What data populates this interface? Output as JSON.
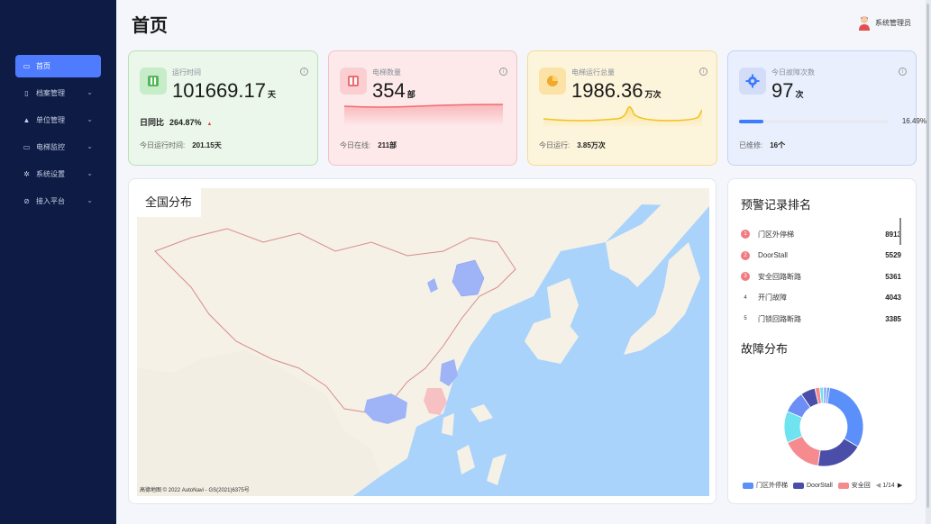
{
  "sidebar": {
    "items": [
      {
        "label": "首页",
        "icon": "monitor-icon",
        "active": true
      },
      {
        "label": "档案管理",
        "icon": "file-icon",
        "active": false
      },
      {
        "label": "单位管理",
        "icon": "building-icon",
        "active": false
      },
      {
        "label": "电梯监控",
        "icon": "screen-icon",
        "active": false
      },
      {
        "label": "系统设置",
        "icon": "gear-icon",
        "active": false
      },
      {
        "label": "接入平台",
        "icon": "link-icon",
        "active": false
      }
    ]
  },
  "header": {
    "title": "首页",
    "user": "系统管理员"
  },
  "cards": [
    {
      "label": "运行时间",
      "value": "101669.17",
      "unit": "天",
      "yoy_label": "日同比",
      "yoy_value": "264.87%",
      "foot_label": "今日运行时间:",
      "foot_value": "201.15天"
    },
    {
      "label": "电梯数量",
      "value": "354",
      "unit": "部",
      "foot_label": "今日在线:",
      "foot_value": "211部"
    },
    {
      "label": "电梯运行总量",
      "value": "1986.36",
      "unit": "万次",
      "foot_label": "今日运行:",
      "foot_value": "3.85万次"
    },
    {
      "label": "今日故障次数",
      "value": "97",
      "unit": "次",
      "progress_pct": "16.49%",
      "progress": 0.1649,
      "foot_label": "已维修:",
      "foot_value": "16个"
    }
  ],
  "map": {
    "title": "全国分布",
    "credit": "高德地图 © 2022 AutoNavi - GS(2021)6375号"
  },
  "ranking": {
    "title": "预警记录排名",
    "rows": [
      {
        "rank": "1",
        "name": "门区外停梯",
        "value": "8913"
      },
      {
        "rank": "2",
        "name": "DoorStall",
        "value": "5529"
      },
      {
        "rank": "3",
        "name": "安全回路断路",
        "value": "5361"
      },
      {
        "rank": "4",
        "name": "开门故障",
        "value": "4043"
      },
      {
        "rank": "5",
        "name": "门锁回路断路",
        "value": "3385"
      }
    ]
  },
  "faults": {
    "title": "故障分布",
    "legend": [
      {
        "label": "门区外停梯",
        "color": "#5b8ff9"
      },
      {
        "label": "DoorStall",
        "color": "#4a4ea8"
      },
      {
        "label": "安全回",
        "color": "#f58a8f"
      }
    ],
    "pager": "1/14",
    "chart_data": {
      "type": "pie",
      "values": [
        31,
        19,
        16,
        13,
        9,
        6,
        2,
        1.5,
        1.5,
        1
      ],
      "colors": [
        "#5b8ff9",
        "#4a4ea8",
        "#f58a8f",
        "#6fe3f0",
        "#6c8ef5",
        "#4a4ea8",
        "#f58a8f",
        "#6fe3f0",
        "#9ab0f7",
        "#5b8ff9"
      ]
    }
  }
}
